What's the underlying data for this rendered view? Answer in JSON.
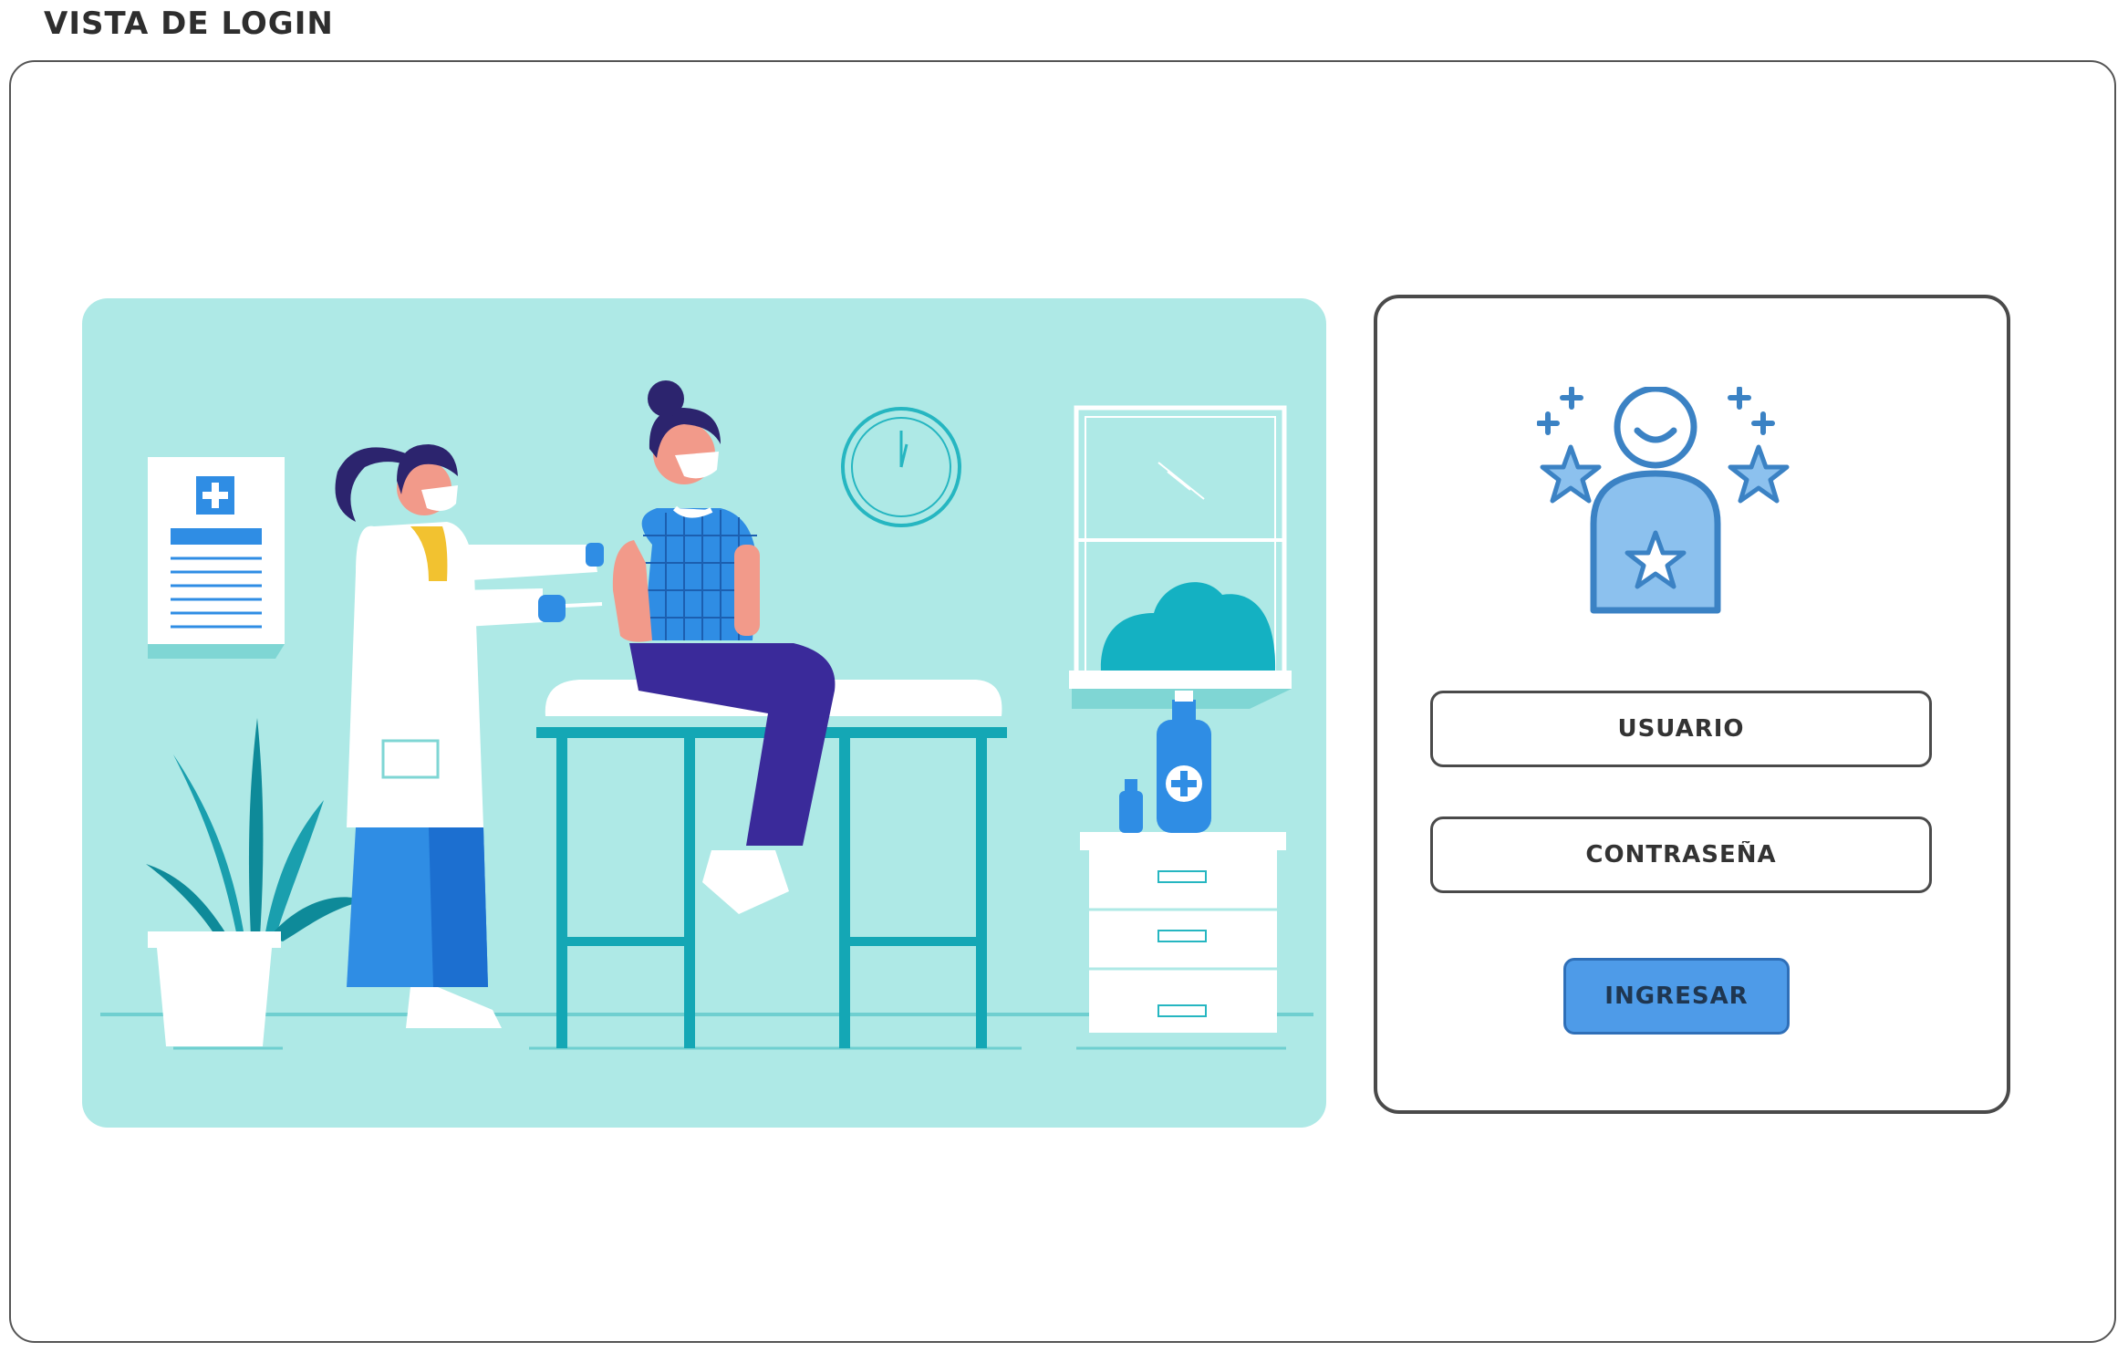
{
  "page": {
    "title": "VISTA DE LOGIN"
  },
  "login": {
    "username_placeholder": "USUARIO",
    "password_placeholder": "CONTRASEÑA",
    "submit_label": "INGRESAR"
  },
  "icons": {
    "hero": "vaccination-illustration",
    "user": "star-user-icon"
  },
  "colors": {
    "illustration_bg": "#aee9e6",
    "accent_blue": "#4e9be8",
    "icon_blue": "#3b82c4",
    "icon_fill": "#8cc1ee",
    "text_dark": "#2e2e2e"
  }
}
